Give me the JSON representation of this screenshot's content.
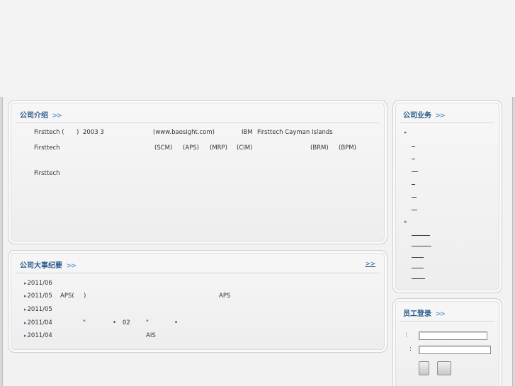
{
  "intro": {
    "title": "公司介绍",
    "chevron": ">>",
    "line1": {
      "a": "Firsttech (",
      "b": ")",
      "c": "2003 3",
      "d": "(www.baosight.com)",
      "e": "IBM",
      "f": "Firsttech Cayman Islands"
    },
    "line2": {
      "a": "Firsttech",
      "b": "(SCM)",
      "c": "(APS)",
      "d": "(MRP)",
      "e": "(CIM)",
      "f": "(BRM)",
      "g": "(BPM)"
    },
    "line3": {
      "a": "Firsttech"
    }
  },
  "events": {
    "title": "公司大事纪要",
    "chevron": ">>",
    "more": ">>",
    "rows": [
      {
        "date": "2011/06"
      },
      {
        "date": "2011/05",
        "t1": "APS(",
        "t2": ")",
        "t3": "APS"
      },
      {
        "date": "2011/05"
      },
      {
        "date": "2011/04",
        "t1": "\"",
        "t2": "•",
        "t3": "02",
        "t4": "\"",
        "t5": "•"
      },
      {
        "date": "2011/04",
        "t1": "AIS"
      }
    ]
  },
  "business": {
    "title": "公司业务",
    "chevron": ">>"
  },
  "login": {
    "title": "员工登录",
    "chevron": ">>",
    "colon1": ":",
    "colon2": ":",
    "username": "",
    "password": ""
  }
}
